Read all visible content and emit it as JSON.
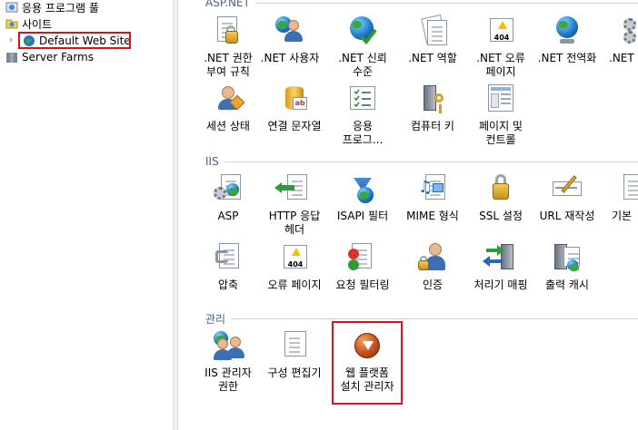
{
  "tree": {
    "items": [
      {
        "label": "응용 프로그램 풀"
      },
      {
        "label": "사이트"
      },
      {
        "label": "Default Web Site"
      },
      {
        "label": "Server Farms"
      }
    ]
  },
  "groups": {
    "aspnet": "ASP.NET",
    "iis": "IIS",
    "management": "관리"
  },
  "aspnet_features": [
    {
      "label": ".NET 권한\n부여 규칙",
      "icon": "net-authorization-icon"
    },
    {
      "label": ".NET 사용자",
      "icon": "net-users-icon"
    },
    {
      "label": ".NET 신뢰\n수준",
      "icon": "net-trust-levels-icon"
    },
    {
      "label": ".NET 역할",
      "icon": "net-roles-icon"
    },
    {
      "label": ".NET 오류\n페이지",
      "icon": "net-error-pages-icon"
    },
    {
      "label": ".NET 전역화",
      "icon": "net-globalization-icon"
    },
    {
      "label": ".NET 컴",
      "icon": "net-compilation-icon"
    },
    {
      "label": "세션 상태",
      "icon": "session-state-icon"
    },
    {
      "label": "연결 문자열",
      "icon": "connection-strings-icon"
    },
    {
      "label": "응용\n프로그...",
      "icon": "application-settings-icon"
    },
    {
      "label": "컴퓨터 키",
      "icon": "machine-key-icon"
    },
    {
      "label": "페이지 및\n컨트롤",
      "icon": "pages-controls-icon"
    }
  ],
  "iis_features": [
    {
      "label": "ASP",
      "icon": "asp-icon"
    },
    {
      "label": "HTTP 응답\n헤더",
      "icon": "http-response-headers-icon"
    },
    {
      "label": "ISAPI 필터",
      "icon": "isapi-filters-icon"
    },
    {
      "label": "MIME 형식",
      "icon": "mime-types-icon"
    },
    {
      "label": "SSL 설정",
      "icon": "ssl-settings-icon"
    },
    {
      "label": "URL 재작성",
      "icon": "url-rewrite-icon"
    },
    {
      "label": "기본",
      "icon": "default-document-icon"
    },
    {
      "label": "압축",
      "icon": "compression-icon"
    },
    {
      "label": "오류 페이지",
      "icon": "error-pages-icon"
    },
    {
      "label": "요청 필터링",
      "icon": "request-filtering-icon"
    },
    {
      "label": "인증",
      "icon": "authentication-icon"
    },
    {
      "label": "처리기 매핑",
      "icon": "handler-mappings-icon"
    },
    {
      "label": "출력 캐시",
      "icon": "output-caching-icon"
    }
  ],
  "management_features": [
    {
      "label": "IIS 관리자\n권한",
      "icon": "iis-manager-permissions-icon"
    },
    {
      "label": "구성 편집기",
      "icon": "configuration-editor-icon"
    },
    {
      "label": "웹 플랫폼\n설치 관리자",
      "icon": "web-platform-installer-icon"
    }
  ],
  "colors": {
    "highlight_border": "#e0101b",
    "group_header": "#4d6185"
  }
}
